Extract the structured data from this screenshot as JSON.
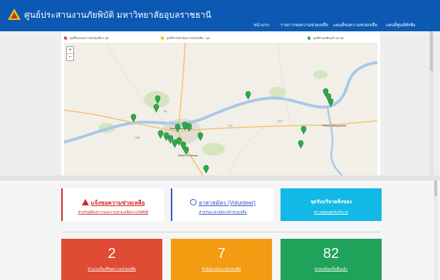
{
  "header": {
    "title": "ศูนย์ประสานงานภัยพิบัติ มหาวิทยาลัยอุบลราชธานี",
    "nav": [
      "หน้าแรก",
      "รายการขอความช่วยเหลือ",
      "แผนที่ขอความช่วยเหลือ",
      "แผนที่ศูนย์พักพิง"
    ]
  },
  "legend": [
    {
      "text": "จุดที่ร้องขอความช่วยเหลือ 2 จุด",
      "color": "#e0423a"
    },
    {
      "text": "จุดที่กำลังดำเนินการช่วยเหลือ 7 จุด",
      "color": "#f1c40f"
    },
    {
      "text": "จุดที่ช่วยเหลือแล้ว 82 จุด",
      "color": "#2eaa4a"
    }
  ],
  "map": {
    "zoom_in": "+",
    "zoom_out": "−",
    "labels": [
      "Warin Chamrap",
      "Ubon Ratchathani",
      "Phibun Mangsahan"
    ],
    "road_numbers": [
      "24",
      "212",
      "231",
      "217"
    ]
  },
  "cards": {
    "help": {
      "title": "แจ้งขอความช่วยเหลือ",
      "sub": "สำหรับผู้ต้องการขอความช่วยเหลือจากภัยพิบัติ"
    },
    "volunteer": {
      "title": "อาสาสมัคร (Volunteer)",
      "sub": "สำหรับอาสาสมัครเข้าช่วยเหลือ"
    },
    "donate": {
      "title": "จุดรับบริจาคสิ่งของ",
      "sub": "ตรวจสอบจุดรับบริจาค"
    }
  },
  "stats": [
    {
      "value": "2",
      "label": "จำนวนเรื่องที่ขอความช่วยเหลือ"
    },
    {
      "value": "7",
      "label": "กำลังดำเนินการช่วยเหลือ"
    },
    {
      "value": "82",
      "label": "ช่วยเหลือเสร็จสิ้นแล้ว"
    }
  ],
  "colors": {
    "navbar": "#0b59b3",
    "alert": "#d12b2b",
    "volunteer": "#2f56c9",
    "donate": "#12b9e6",
    "stat_red": "#e04c33",
    "stat_orange": "#f39c12",
    "stat_green": "#1fa35a"
  }
}
